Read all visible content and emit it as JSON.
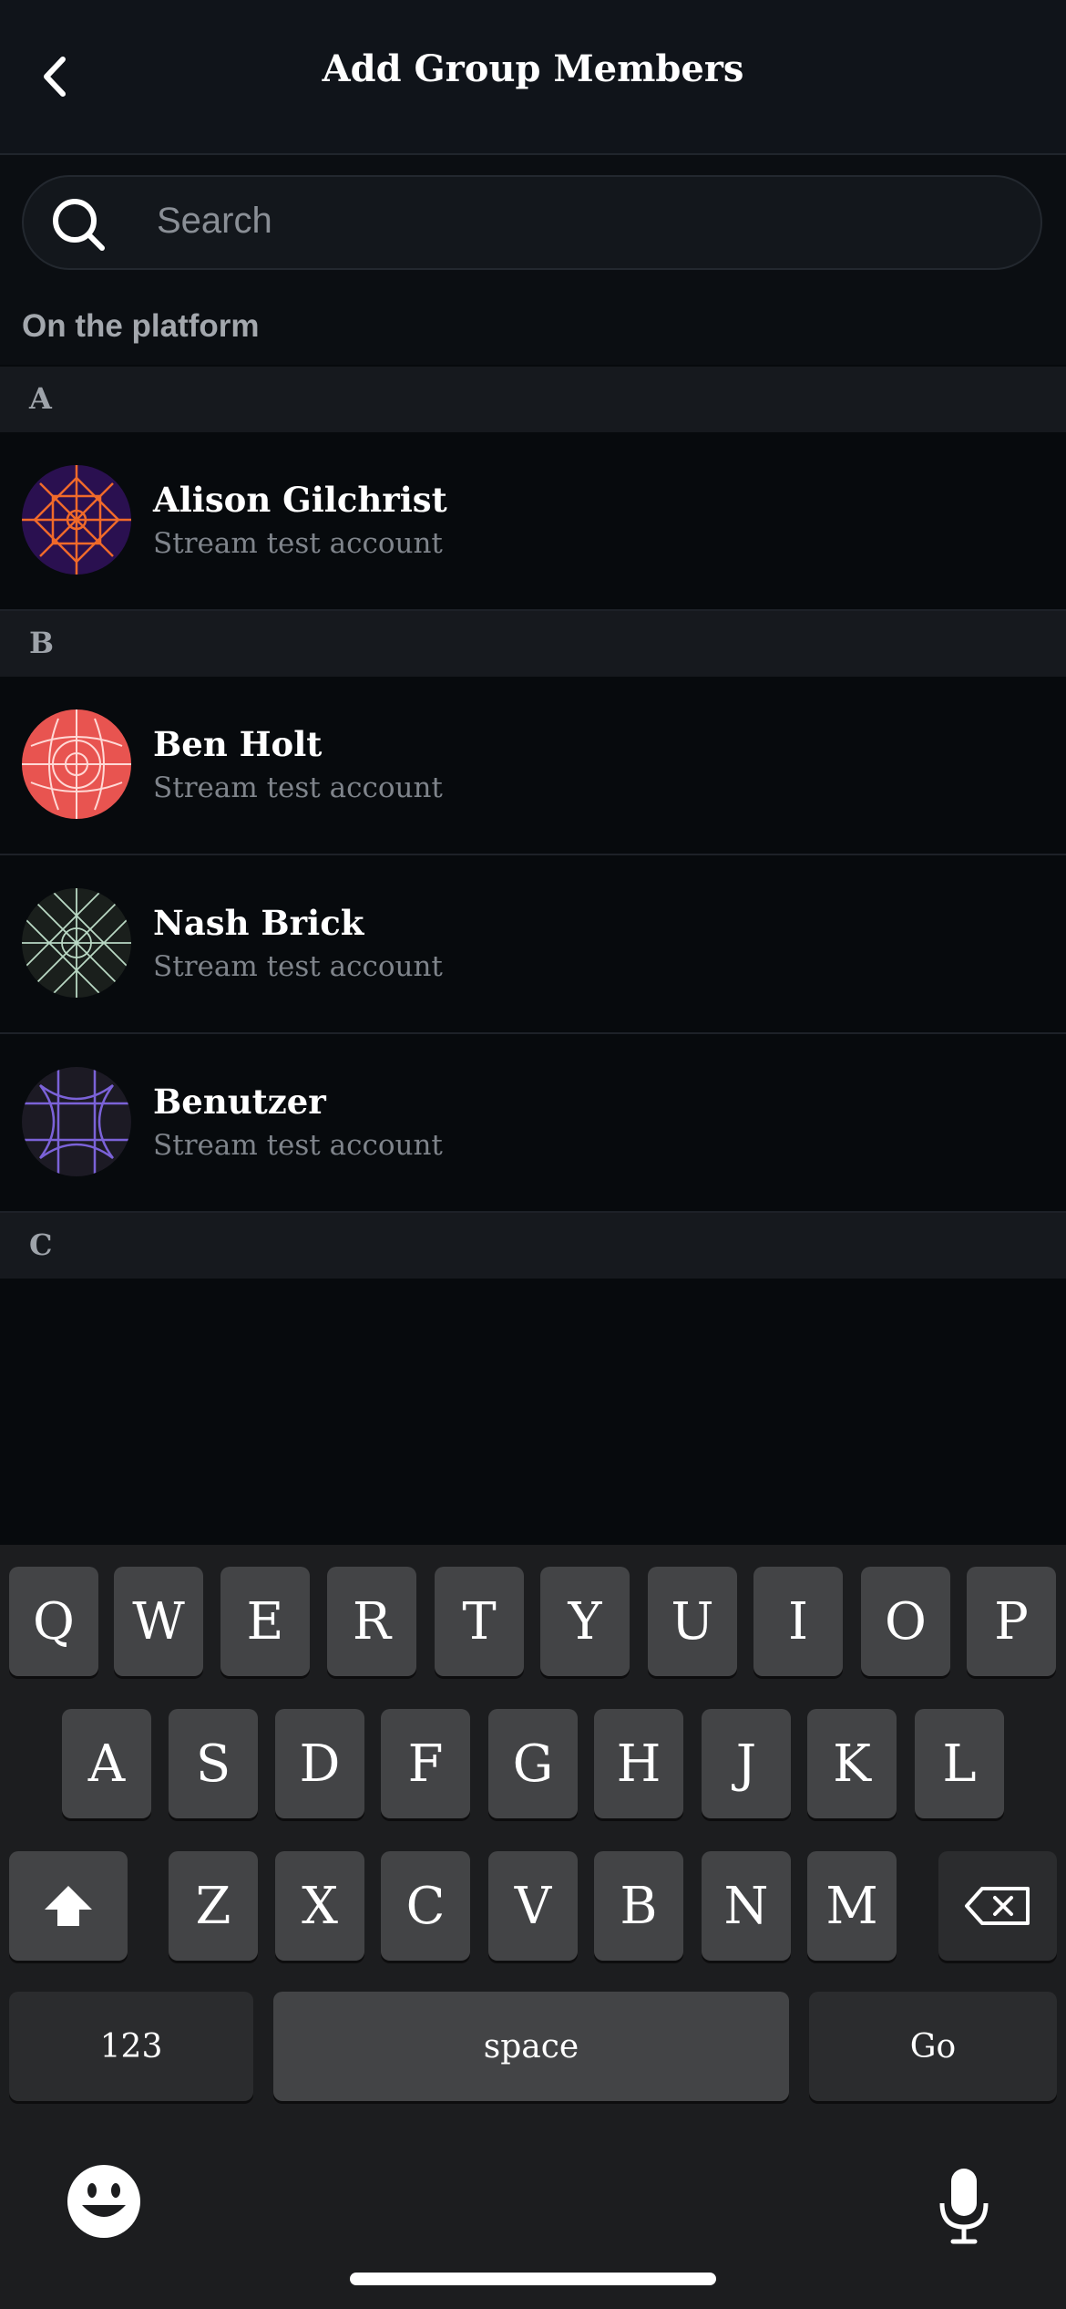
{
  "header": {
    "title": "Add Group Members",
    "back_icon": "chevron-left-icon"
  },
  "search": {
    "placeholder": "Search",
    "icon": "search-icon"
  },
  "platform_label": "On the platform",
  "sections": [
    {
      "letter": "A"
    },
    {
      "letter": "B"
    },
    {
      "letter": "C"
    }
  ],
  "contacts": [
    {
      "name": "Alison Gilchrist",
      "subtitle": "Stream test account",
      "avatar_color": "#2a1050"
    },
    {
      "name": "Ben Holt",
      "subtitle": "Stream test account",
      "avatar_color": "#e85450"
    },
    {
      "name": "Nash Brick",
      "subtitle": "Stream test account",
      "avatar_color": "#1a1f1c"
    },
    {
      "name": "Benutzer",
      "subtitle": "Stream test account",
      "avatar_color": "#1c1a24"
    }
  ],
  "keyboard": {
    "row1": [
      "Q",
      "W",
      "E",
      "R",
      "T",
      "Y",
      "U",
      "I",
      "O",
      "P"
    ],
    "row2": [
      "A",
      "S",
      "D",
      "F",
      "G",
      "H",
      "J",
      "K",
      "L"
    ],
    "row3": [
      "Z",
      "X",
      "C",
      "V",
      "B",
      "N",
      "M"
    ],
    "numbers_label": "123",
    "space_label": "space",
    "go_label": "Go"
  }
}
